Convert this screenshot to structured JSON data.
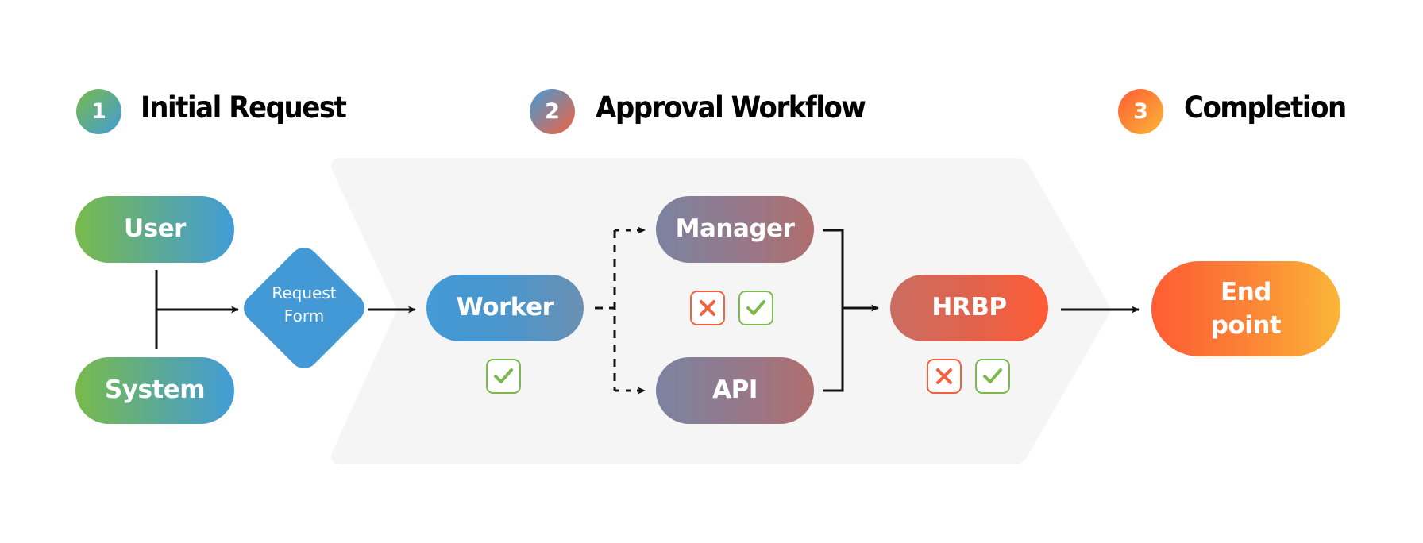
{
  "stages": [
    {
      "number": "1",
      "title": "Initial Request"
    },
    {
      "number": "2",
      "title": "Approval Workflow"
    },
    {
      "number": "3",
      "title": "Completion"
    }
  ],
  "nodes": {
    "user": "User",
    "system": "System",
    "request_form": [
      "Request",
      "Form"
    ],
    "worker": "Worker",
    "manager": "Manager",
    "api": "API",
    "hrbp": "HRBP",
    "end_point": [
      "End",
      "point"
    ]
  },
  "status_icons": {
    "worker": [
      "approve"
    ],
    "manager_api": [
      "reject",
      "approve"
    ],
    "hrbp": [
      "reject",
      "approve"
    ]
  },
  "colors": {
    "stage1": [
      "#79BA4B",
      "#429CD6"
    ],
    "stage2": [
      "#429CD6",
      "#F2623F"
    ],
    "stage3": [
      "#FE5C34",
      "#FBB637"
    ],
    "reject": "#F2623F",
    "approve": "#7CB84E",
    "panel": "#F5F5F5",
    "connector": "#111111"
  }
}
